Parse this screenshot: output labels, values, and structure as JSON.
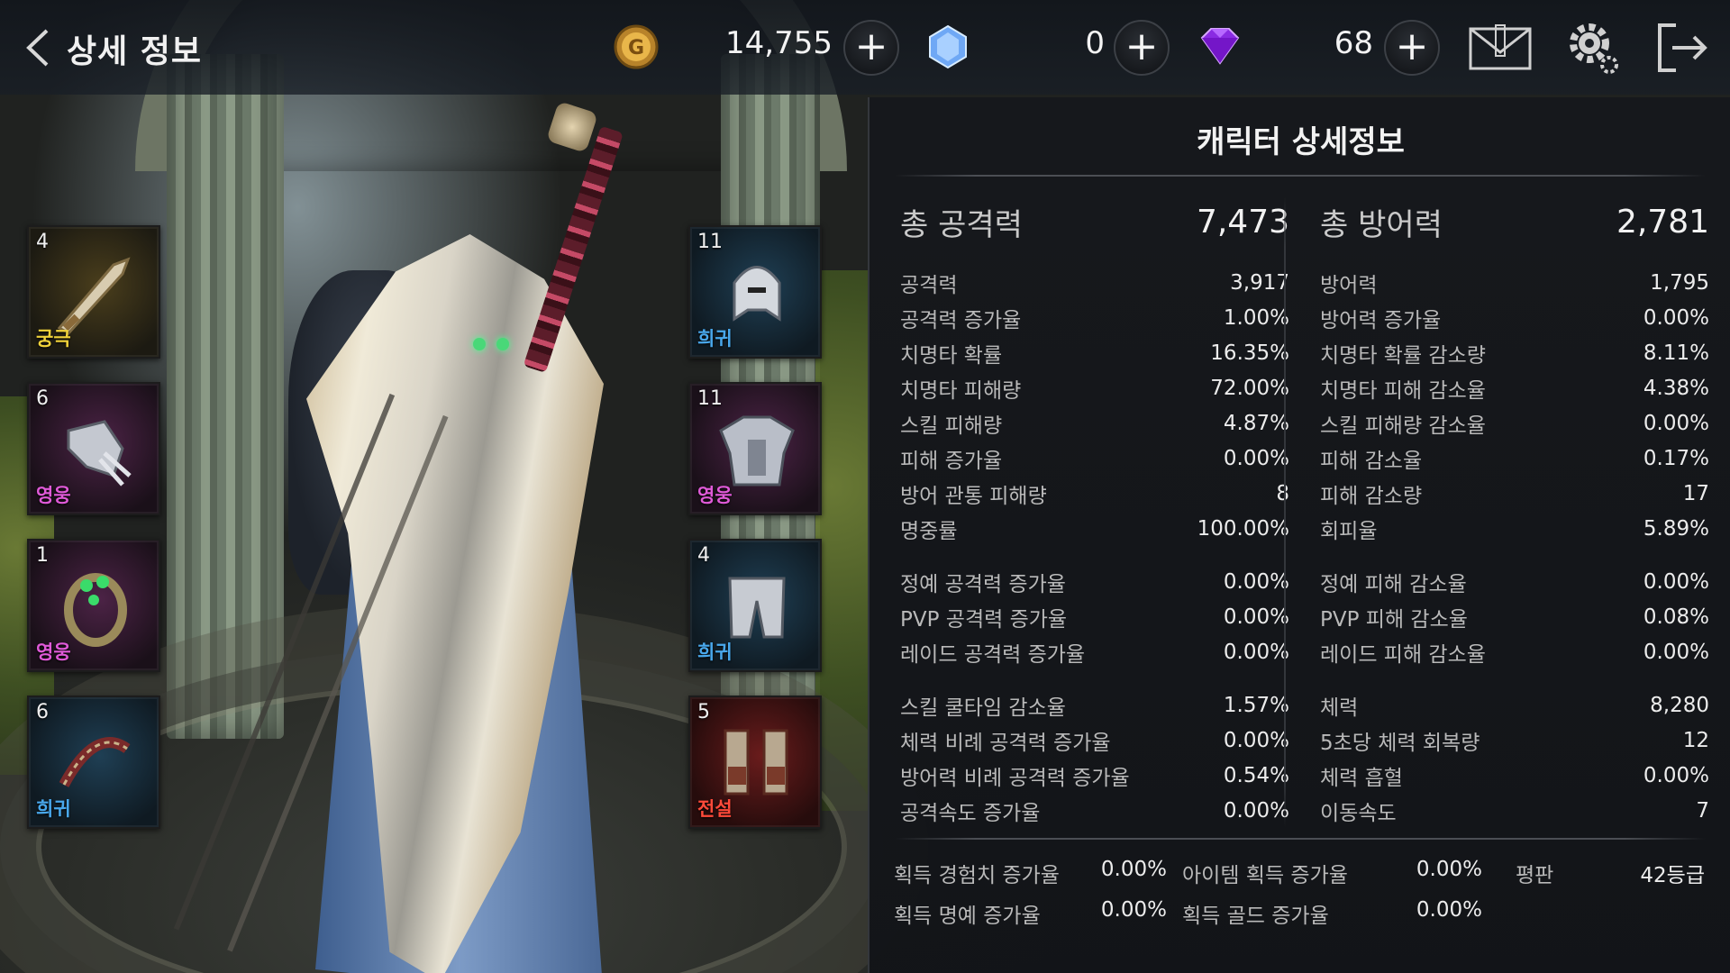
{
  "header": {
    "title": "상세 정보",
    "gold": "14,755",
    "crystal": "0",
    "gem": "68"
  },
  "equipment": {
    "left": [
      {
        "level": "4",
        "grade": "궁극",
        "grade_color": "#f0d23a",
        "item": "sword",
        "bg": "ultimate"
      },
      {
        "level": "6",
        "grade": "영웅",
        "grade_color": "#e05ad8",
        "item": "gauntlet",
        "bg": "hero"
      },
      {
        "level": "1",
        "grade": "영웅",
        "grade_color": "#e05ad8",
        "item": "ring",
        "bg": "hero"
      },
      {
        "level": "6",
        "grade": "희귀",
        "grade_color": "#49a8ec",
        "item": "bracelet",
        "bg": "rare"
      }
    ],
    "right": [
      {
        "level": "11",
        "grade": "희귀",
        "grade_color": "#49a8ec",
        "item": "helmet",
        "bg": "rare"
      },
      {
        "level": "11",
        "grade": "영웅",
        "grade_color": "#e05ad8",
        "item": "chest-armor",
        "bg": "hero"
      },
      {
        "level": "4",
        "grade": "희귀",
        "grade_color": "#49a8ec",
        "item": "leg-armor",
        "bg": "rare"
      },
      {
        "level": "5",
        "grade": "전설",
        "grade_color": "#ff4a3a",
        "item": "boots",
        "bg": "legend"
      }
    ]
  },
  "panel": {
    "title": "캐릭터 상세정보",
    "attack": {
      "total_label": "총 공격력",
      "total_value": "7,473",
      "groups": [
        [
          {
            "label": "공격력",
            "value": "3,917"
          },
          {
            "label": "공격력 증가율",
            "value": "1.00%"
          },
          {
            "label": "치명타 확률",
            "value": "16.35%"
          },
          {
            "label": "치명타 피해량",
            "value": "72.00%"
          },
          {
            "label": "스킬 피해량",
            "value": "4.87%"
          },
          {
            "label": "피해 증가율",
            "value": "0.00%"
          },
          {
            "label": "방어 관통 피해량",
            "value": "8"
          },
          {
            "label": "명중률",
            "value": "100.00%"
          }
        ],
        [
          {
            "label": "정예 공격력 증가율",
            "value": "0.00%"
          },
          {
            "label": "PVP 공격력 증가율",
            "value": "0.00%"
          },
          {
            "label": "레이드 공격력 증가율",
            "value": "0.00%"
          }
        ],
        [
          {
            "label": "스킬 쿨타임 감소율",
            "value": "1.57%"
          },
          {
            "label": "체력 비례 공격력 증가율",
            "value": "0.00%"
          },
          {
            "label": "방어력 비례 공격력 증가율",
            "value": "0.54%"
          },
          {
            "label": "공격속도 증가율",
            "value": "0.00%"
          }
        ]
      ]
    },
    "defense": {
      "total_label": "총 방어력",
      "total_value": "2,781",
      "groups": [
        [
          {
            "label": "방어력",
            "value": "1,795"
          },
          {
            "label": "방어력 증가율",
            "value": "0.00%"
          },
          {
            "label": "치명타 확률 감소량",
            "value": "8.11%"
          },
          {
            "label": "치명타 피해 감소율",
            "value": "4.38%"
          },
          {
            "label": "스킬 피해량 감소율",
            "value": "0.00%"
          },
          {
            "label": "피해 감소율",
            "value": "0.17%"
          },
          {
            "label": "피해 감소량",
            "value": "17"
          },
          {
            "label": "회피율",
            "value": "5.89%"
          }
        ],
        [
          {
            "label": "정예 피해 감소율",
            "value": "0.00%"
          },
          {
            "label": "PVP 피해 감소율",
            "value": "0.08%"
          },
          {
            "label": "레이드 피해 감소율",
            "value": "0.00%"
          }
        ],
        [
          {
            "label": "체력",
            "value": "8,280"
          },
          {
            "label": "5초당 체력 회복량",
            "value": "12"
          },
          {
            "label": "체력 흡혈",
            "value": "0.00%"
          },
          {
            "label": "이동속도",
            "value": "7"
          }
        ]
      ]
    },
    "extras": {
      "exp_label": "획득 경험치 증가율",
      "exp_value": "0.00%",
      "item_label": "아이템 획득 증가율",
      "item_value": "0.00%",
      "rep_label": "평판",
      "rep_value": "42등급",
      "honor_label": "획득 명예 증가율",
      "honor_value": "0.00%",
      "gold_label": "획득 골드 증가율",
      "gold_value": "0.00%"
    }
  }
}
